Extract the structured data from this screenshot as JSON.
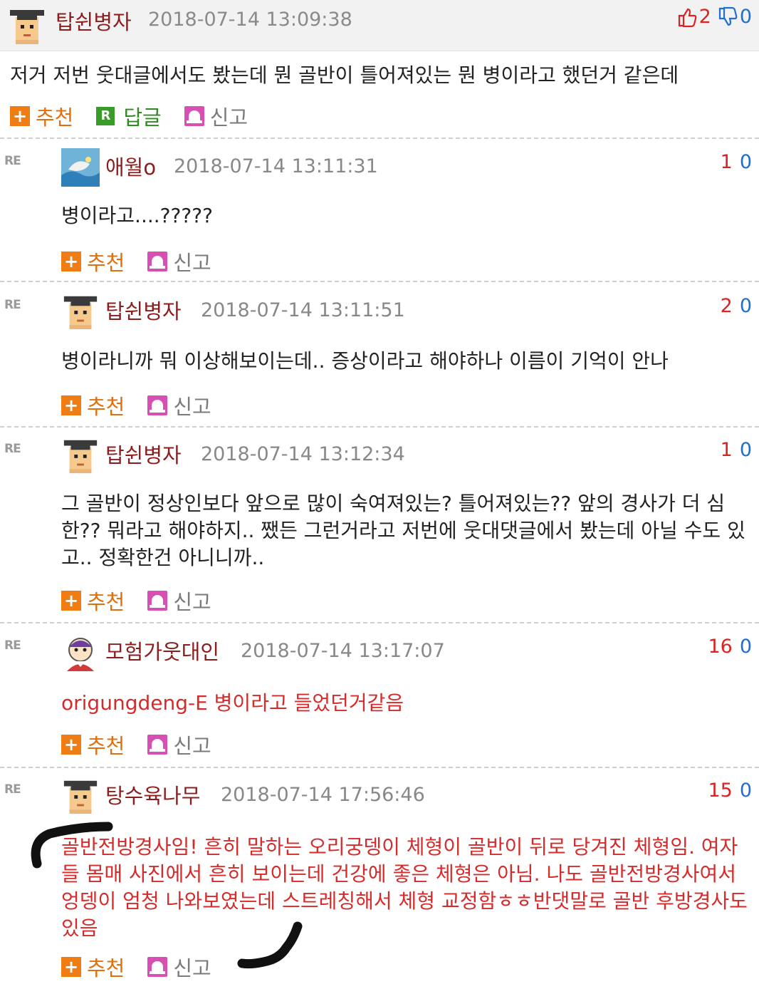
{
  "post": {
    "nickname": "탑쉰병자",
    "date": "2018-07-14 13:09:38",
    "up_count": "2",
    "down_count": "0",
    "text": "저거 저번 웃대글에서도 봤는데 뭔 골반이 틀어져있는 뭔 병이라고 했던거 같은데",
    "actions": {
      "recommend": "추천",
      "reply": "답글",
      "report": "신고",
      "reply_badge": "R"
    }
  },
  "re_label": "RE",
  "replies": [
    {
      "nickname": "애월o",
      "date": "2018-07-14 13:11:31",
      "up": "1",
      "down": "0",
      "text": "병이라고....?????",
      "recommend": "추천",
      "report": "신고"
    },
    {
      "nickname": "탑쉰병자",
      "date": "2018-07-14 13:11:51",
      "up": "2",
      "down": "0",
      "text": "병이라니까 뭐 이상해보이는데.. 증상이라고 해야하나 이름이 기억이 안나",
      "recommend": "추천",
      "report": "신고"
    },
    {
      "nickname": "탑쉰병자",
      "date": "2018-07-14 13:12:34",
      "up": "1",
      "down": "0",
      "text": "그 골반이 정상인보다 앞으로 많이 숙여져있는? 틀어져있는?? 앞의 경사가 더 심한?? 뭐라고 해야하지.. 쨌든 그런거라고 저번에 웃대댓글에서 봤는데 아닐 수도 있고.. 정확한건 아니니까..",
      "recommend": "추천",
      "report": "신고"
    },
    {
      "nickname": "모험가웃대인",
      "date": "2018-07-14 13:17:07",
      "up": "16",
      "down": "0",
      "text": "origungdeng-E 병이라고 들었던거같음",
      "recommend": "추천",
      "report": "신고"
    },
    {
      "nickname": "탕수육나무",
      "date": "2018-07-14 17:56:46",
      "up": "15",
      "down": "0",
      "text": "골반전방경사임! 흔히 말하는 오리궁뎅이 체형이 골반이 뒤로 당겨진 체형임. 여자들 몸매 사진에서 흔히 보이는데 건강에 좋은 체형은 아님. 나도 골반전방경사여서 엉뎅이 엄청 나와보였는데 스트레칭해서 체형 교정함ㅎㅎ반댓말로 골반 후방경사도 있음",
      "recommend": "추천",
      "report": "신고"
    }
  ],
  "colors": {
    "nick": "#8c1d1d",
    "highlight_text": "#d52b2b",
    "up": "#dd2222",
    "down": "#1e6fd0",
    "recommend": "#e36f0c"
  }
}
